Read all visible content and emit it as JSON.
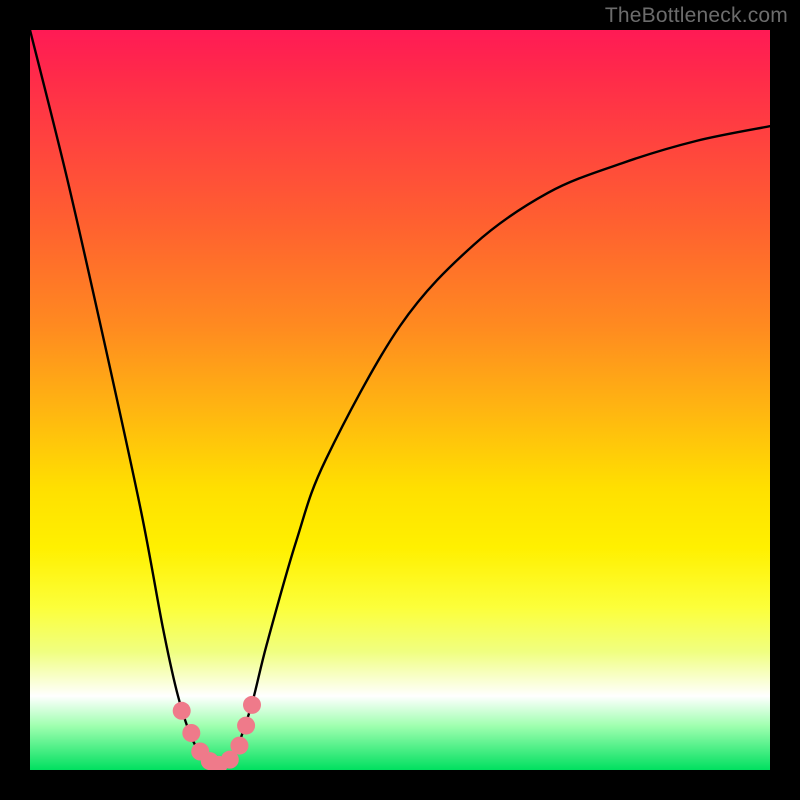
{
  "watermark": "TheBottleneck.com",
  "chart_data": {
    "type": "line",
    "title": "",
    "xlabel": "",
    "ylabel": "",
    "xlim": [
      0,
      100
    ],
    "ylim": [
      0,
      100
    ],
    "series": [
      {
        "name": "bottleneck-curve",
        "x": [
          0,
          5,
          10,
          15,
          18,
          20,
          22,
          24,
          25,
          26,
          27,
          28,
          30,
          32,
          36,
          40,
          50,
          60,
          70,
          80,
          90,
          100
        ],
        "values": [
          100,
          80,
          58,
          35,
          19,
          10,
          4,
          1,
          0,
          0,
          1,
          3,
          9,
          17,
          31,
          42,
          60,
          71,
          78,
          82,
          85,
          87
        ]
      }
    ],
    "markers": {
      "name": "highlight-dots",
      "color": "#ef7a8a",
      "points": [
        {
          "x": 20.5,
          "y": 8
        },
        {
          "x": 21.8,
          "y": 5
        },
        {
          "x": 23.0,
          "y": 2.5
        },
        {
          "x": 24.3,
          "y": 1.2
        },
        {
          "x": 25.5,
          "y": 0.7
        },
        {
          "x": 27.0,
          "y": 1.4
        },
        {
          "x": 28.3,
          "y": 3.3
        },
        {
          "x": 29.2,
          "y": 6.0
        },
        {
          "x": 30.0,
          "y": 8.8
        }
      ]
    },
    "gradient_stops": [
      {
        "pos": 0.0,
        "color": "#ff1a55"
      },
      {
        "pos": 0.14,
        "color": "#ff4040"
      },
      {
        "pos": 0.4,
        "color": "#ff8a20"
      },
      {
        "pos": 0.62,
        "color": "#ffe000"
      },
      {
        "pos": 0.84,
        "color": "#f0ff80"
      },
      {
        "pos": 0.9,
        "color": "#ffffff"
      },
      {
        "pos": 1.0,
        "color": "#00e060"
      }
    ]
  }
}
